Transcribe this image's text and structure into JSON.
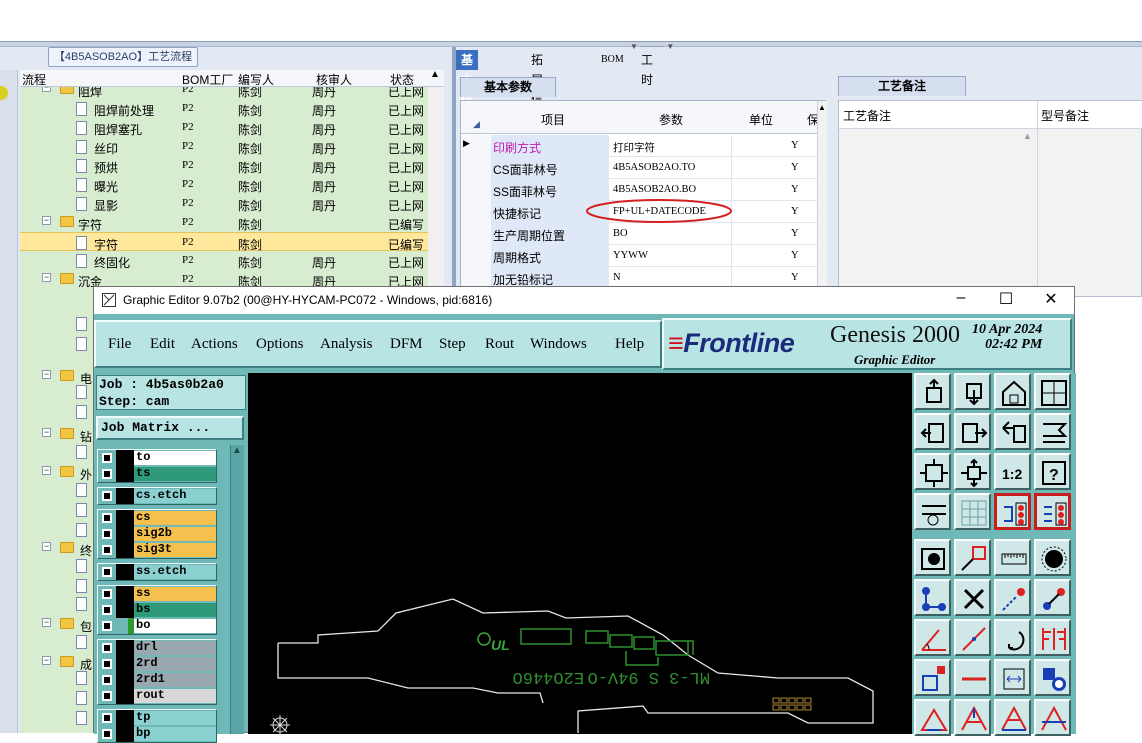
{
  "left_panel": {
    "title": "【4B5ASOB2AO】工艺流程",
    "columns": [
      "流程",
      "BOM工厂",
      "编写人",
      "核审人",
      "状态"
    ],
    "rows": [
      {
        "level": 1,
        "kind": "folder",
        "name": "阻焊",
        "bom": "P2",
        "writer": "陈剑",
        "reviewer": "周丹",
        "status": "已上网"
      },
      {
        "level": 2,
        "kind": "doc",
        "name": "阻焊前处理",
        "bom": "P2",
        "writer": "陈剑",
        "reviewer": "周丹",
        "status": "已上网"
      },
      {
        "level": 2,
        "kind": "doc",
        "name": "阻焊塞孔",
        "bom": "P2",
        "writer": "陈剑",
        "reviewer": "周丹",
        "status": "已上网"
      },
      {
        "level": 2,
        "kind": "doc",
        "name": "丝印",
        "bom": "P2",
        "writer": "陈剑",
        "reviewer": "周丹",
        "status": "已上网"
      },
      {
        "level": 2,
        "kind": "doc",
        "name": "预烘",
        "bom": "P2",
        "writer": "陈剑",
        "reviewer": "周丹",
        "status": "已上网"
      },
      {
        "level": 2,
        "kind": "doc",
        "name": "曝光",
        "bom": "P2",
        "writer": "陈剑",
        "reviewer": "周丹",
        "status": "已上网"
      },
      {
        "level": 2,
        "kind": "doc",
        "name": "显影",
        "bom": "P2",
        "writer": "陈剑",
        "reviewer": "周丹",
        "status": "已上网"
      },
      {
        "level": 1,
        "kind": "folder",
        "name": "字符",
        "bom": "P2",
        "writer": "陈剑",
        "reviewer": "",
        "status": "已编写"
      },
      {
        "level": 2,
        "kind": "doc",
        "name": "字符",
        "bom": "P2",
        "writer": "陈剑",
        "reviewer": "",
        "status": "已编写",
        "selected": true
      },
      {
        "level": 2,
        "kind": "doc",
        "name": "终固化",
        "bom": "P2",
        "writer": "陈剑",
        "reviewer": "周丹",
        "status": "已上网"
      },
      {
        "level": 1,
        "kind": "folder",
        "name": "沉金",
        "bom": "P2",
        "writer": "陈剑",
        "reviewer": "周丹",
        "status": "已上网"
      }
    ],
    "hidden_folders": [
      "电",
      "钻",
      "外",
      "终",
      "包",
      "成"
    ]
  },
  "right_panel": {
    "tabs": [
      "基本信息",
      "拓展信息",
      "BOM",
      "工时"
    ],
    "active_tab": "基本信息",
    "subtab": "基本参数",
    "grid_columns": [
      "项目",
      "参数",
      "单位",
      "保"
    ],
    "grid_rows": [
      {
        "item": "印刷方式",
        "param": "打印字符",
        "unit": "",
        "flag": "Y",
        "current": true
      },
      {
        "item": "CS面菲林号",
        "param": "4B5ASOB2AO.TO",
        "unit": "",
        "flag": "Y"
      },
      {
        "item": "SS面菲林号",
        "param": "4B5ASOB2AO.BO",
        "unit": "",
        "flag": "Y"
      },
      {
        "item": "快捷标记",
        "param": "FP+UL+DATECODE",
        "unit": "",
        "flag": "Y",
        "circled": true
      },
      {
        "item": "生产周期位置",
        "param": "BO",
        "unit": "",
        "flag": "Y"
      },
      {
        "item": "周期格式",
        "param": "YYWW",
        "unit": "",
        "flag": "Y"
      },
      {
        "item": "加无铅标记",
        "param": "N",
        "unit": "",
        "flag": "Y"
      }
    ],
    "notes_tab": "工艺备注",
    "notes_columns": [
      "工艺备注",
      "型号备注"
    ]
  },
  "genesis": {
    "title": "Graphic Editor 9.07b2 (00@HY-HYCAM-PC072 - Windows, pid:6816)",
    "menu": [
      "File",
      "Edit",
      "Actions",
      "Options",
      "Analysis",
      "DFM",
      "Step",
      "Rout",
      "Windows",
      "Help"
    ],
    "brand": "Frontline",
    "product": "Genesis 2000",
    "product_sub": "Graphic Editor",
    "date_line1": "10 Apr 2024",
    "date_line2": "02:42 PM",
    "job_line": "Job : 4b5as0b2a0",
    "step_line": "Step: cam",
    "matrix_button": "Job Matrix ...",
    "layer_groups": [
      [
        {
          "name": "to",
          "color": "#ffffff"
        },
        {
          "name": "ts",
          "color": "#2e9a7a"
        }
      ],
      [
        {
          "name": "cs.etch",
          "color": "#8ad0d0"
        }
      ],
      [
        {
          "name": "cs",
          "color": "#f6c04e"
        },
        {
          "name": "sig2b",
          "color": "#f6c04e"
        },
        {
          "name": "sig3t",
          "color": "#f6c04e"
        }
      ],
      [
        {
          "name": "ss.etch",
          "color": "#8ad0d0"
        }
      ],
      [
        {
          "name": "ss",
          "color": "#f6c04e"
        },
        {
          "name": "bs",
          "color": "#2e9a7a"
        },
        {
          "name": "bo",
          "color": "#ffffff"
        }
      ],
      [
        {
          "name": "drl",
          "color": "#9aa9b0"
        },
        {
          "name": "2rd",
          "color": "#9aa9b0"
        },
        {
          "name": "2rd1",
          "color": "#9aa9b0"
        },
        {
          "name": "rout",
          "color": "#d8d8d8"
        }
      ],
      [
        {
          "name": "tp",
          "color": "#8ad0d0"
        },
        {
          "name": "bp",
          "color": "#8ad0d0"
        }
      ]
    ],
    "canvas_text": {
      "code": "E2O446O",
      "marking": "ML-3 S 94V-O",
      "ul_logo": "UL"
    },
    "toolbar_icons": [
      "zoom-home-icon",
      "zoom-down-icon",
      "home-icon",
      "window-split-icon",
      "pan-left-icon",
      "pan-right-icon",
      "undo-view-icon",
      "layer-stack-icon",
      "zoom-fit-icon",
      "zoom-center-icon",
      "zoom-1to1-icon",
      "help-icon",
      "measure-tool-icon",
      "grid-icon",
      "snap-red-icon",
      "snap-red2-icon",
      "feature-select-icon",
      "shape-edit-icon",
      "ruler-icon",
      "pad-icon",
      "connect-icon",
      "delete-icon",
      "move-icon",
      "copy-icon",
      "line-angle-icon",
      "line-icon",
      "rotate-icon",
      "mirror-icon",
      "node-edit-icon",
      "minus-icon",
      "resize-icon",
      "shapes-icon",
      "triangle-up-icon",
      "triangle-a-icon",
      "triangle-b-icon",
      "triangle-c-icon"
    ]
  }
}
